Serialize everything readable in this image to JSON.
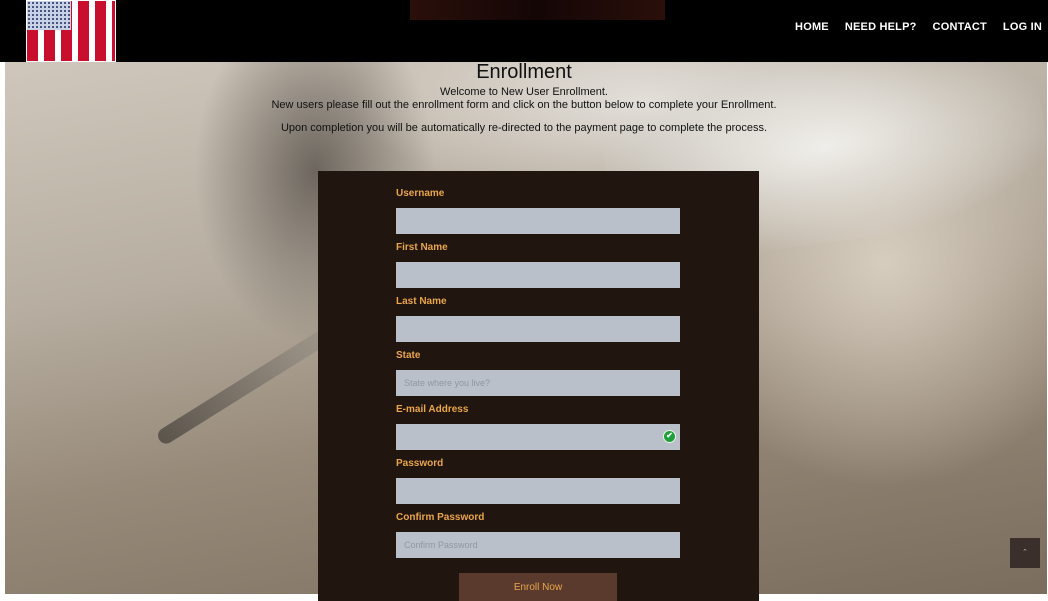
{
  "nav": {
    "home": "HOME",
    "help": "NEED HELP?",
    "contact": "CONTACT",
    "login": "LOG IN"
  },
  "header": {
    "title": "Enrollment",
    "welcome": "Welcome to New User Enrollment.",
    "instructions": "New users please fill out the enrollment form and click on the button below to complete your Enrollment.",
    "redirect_note": "Upon completion you will be automatically re-directed to the payment page to complete the process."
  },
  "form": {
    "username": {
      "label": "Username",
      "value": "",
      "placeholder": ""
    },
    "first_name": {
      "label": "First Name",
      "value": "",
      "placeholder": ""
    },
    "last_name": {
      "label": "Last Name",
      "value": "",
      "placeholder": ""
    },
    "state": {
      "label": "State",
      "value": "",
      "placeholder": "State where you live?"
    },
    "email": {
      "label": "E-mail Address",
      "value": "",
      "placeholder": ""
    },
    "password": {
      "label": "Password",
      "value": "",
      "placeholder": ""
    },
    "confirm_password": {
      "label": "Confirm Password",
      "value": "",
      "placeholder": "Confirm Password"
    },
    "submit_label": "Enroll Now"
  },
  "icons": {
    "logo": "american-flag-logo",
    "email_verify": "verify-icon",
    "scroll_top": "chevron-up-icon",
    "scroll_top_glyph": "ˆ"
  },
  "colors": {
    "navbar_bg": "#000000",
    "panel_bg": "#21150f",
    "label_accent": "#e9a64a",
    "input_bg": "#b9c0c9",
    "button_bg": "#5a3a2d"
  }
}
